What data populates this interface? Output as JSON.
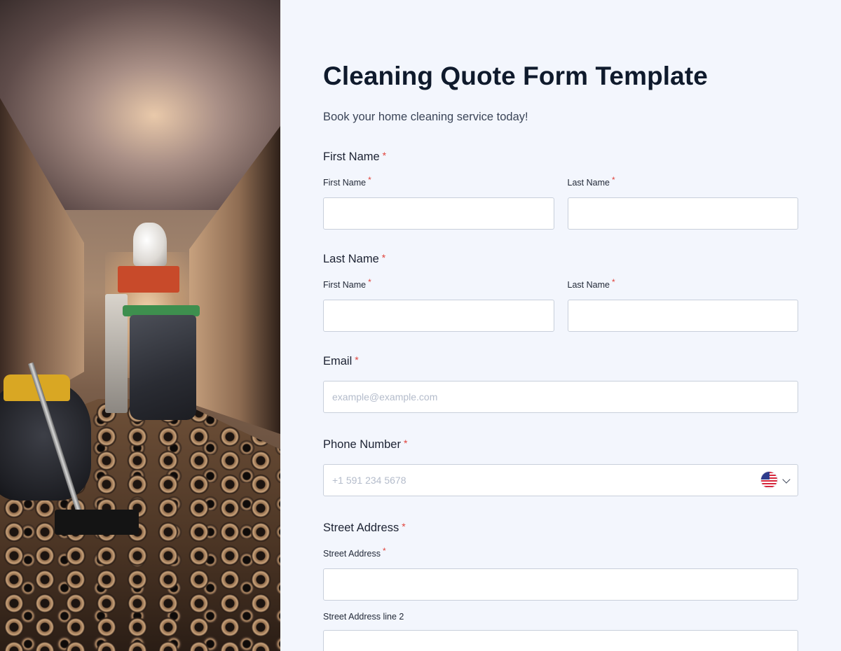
{
  "form": {
    "title": "Cleaning Quote Form Template",
    "subtitle": "Book your home cleaning service today!",
    "required_marker": "*",
    "first_name_section": {
      "label": "First Name",
      "first_sub_label": "First Name",
      "last_sub_label": "Last Name",
      "first_value": "",
      "last_value": ""
    },
    "last_name_section": {
      "label": "Last Name",
      "first_sub_label": "First Name",
      "last_sub_label": "Last Name",
      "first_value": "",
      "last_value": ""
    },
    "email": {
      "label": "Email",
      "placeholder": "example@example.com",
      "value": ""
    },
    "phone": {
      "label": "Phone Number",
      "placeholder": "+1 591 234 5678",
      "value": "",
      "country_icon": "us-flag-icon"
    },
    "street_address": {
      "label": "Street Address",
      "line1_label": "Street Address",
      "line2_label": "Street Address line 2",
      "line1_value": "",
      "line2_value": ""
    }
  },
  "colors": {
    "background": "#f3f6fd",
    "required": "#e0433c",
    "input_border": "#c8cfdb",
    "title": "#0f1a2c"
  }
}
